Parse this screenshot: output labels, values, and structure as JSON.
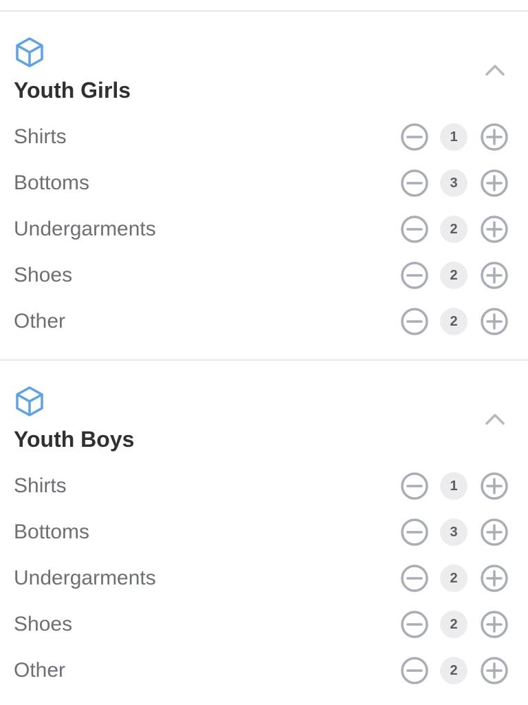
{
  "colors": {
    "accent": "#5ea2e6",
    "divider": "#e5e6e8",
    "title_text": "#2f3033",
    "label_text": "#6d6f76",
    "control_gray": "#a9adb5",
    "qty_bg": "#ececee"
  },
  "sections": [
    {
      "icon": "cube-icon",
      "title": "Youth Girls",
      "collapse_icon": "chevron-up-icon",
      "items": [
        {
          "label": "Shirts",
          "qty": "1"
        },
        {
          "label": "Bottoms",
          "qty": "3"
        },
        {
          "label": "Undergarments",
          "qty": "2"
        },
        {
          "label": "Shoes",
          "qty": "2"
        },
        {
          "label": "Other",
          "qty": "2"
        }
      ]
    },
    {
      "icon": "cube-icon",
      "title": "Youth Boys",
      "collapse_icon": "chevron-up-icon",
      "items": [
        {
          "label": "Shirts",
          "qty": "1"
        },
        {
          "label": "Bottoms",
          "qty": "3"
        },
        {
          "label": "Undergarments",
          "qty": "2"
        },
        {
          "label": "Shoes",
          "qty": "2"
        },
        {
          "label": "Other",
          "qty": "2"
        }
      ]
    }
  ]
}
